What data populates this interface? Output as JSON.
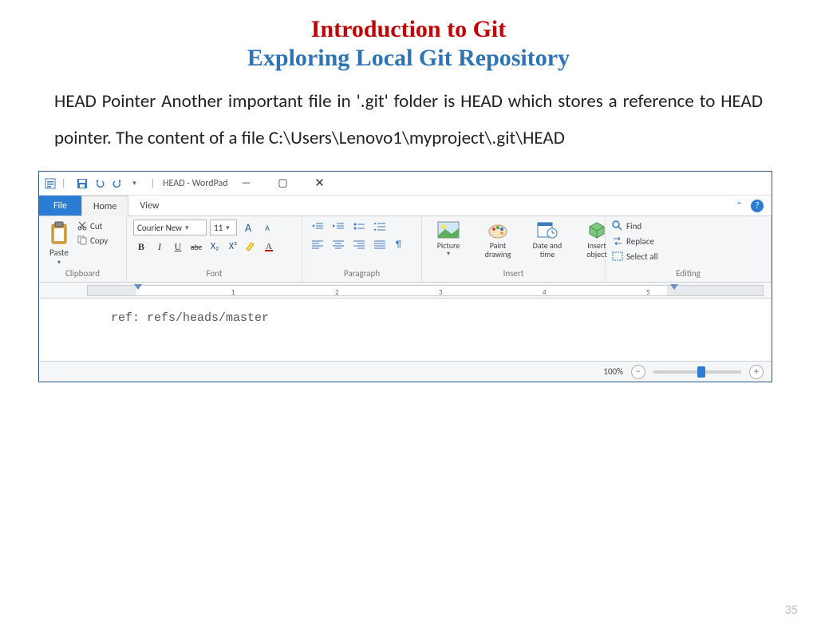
{
  "slide": {
    "title1": "Introduction to Git",
    "title2": "Exploring Local Git Repository",
    "paragraph": "HEAD Pointer Another important file in '.git' folder is HEAD which stores a reference to HEAD pointer. The content of a file C:\\Users\\Lenovo1\\myproject\\.git\\HEAD",
    "page_number": "35"
  },
  "window": {
    "title": "HEAD - WordPad",
    "tabs": {
      "file": "File",
      "home": "Home",
      "view": "View"
    },
    "controls": {
      "minimize": "—",
      "maximize": "▢",
      "close": "✕"
    }
  },
  "ribbon": {
    "clipboard": {
      "label": "Clipboard",
      "paste": "Paste",
      "cut": "Cut",
      "copy": "Copy"
    },
    "font": {
      "label": "Font",
      "family": "Courier New",
      "size": "11",
      "grow": "A",
      "shrink": "A",
      "bold": "B",
      "italic": "I",
      "underline": "U",
      "strike": "abc",
      "sub": "X₂",
      "sup": "X²"
    },
    "paragraph": {
      "label": "Paragraph"
    },
    "insert": {
      "label": "Insert",
      "picture": "Picture",
      "paint": "Paint drawing",
      "datetime": "Date and time",
      "object": "Insert object"
    },
    "editing": {
      "label": "Editing",
      "find": "Find",
      "replace": "Replace",
      "selectall": "Select all"
    }
  },
  "ruler": {
    "n1": "1",
    "n2": "2",
    "n3": "3",
    "n4": "4",
    "n5": "5"
  },
  "document": {
    "content": "ref: refs/heads/master"
  },
  "statusbar": {
    "zoom": "100%"
  }
}
